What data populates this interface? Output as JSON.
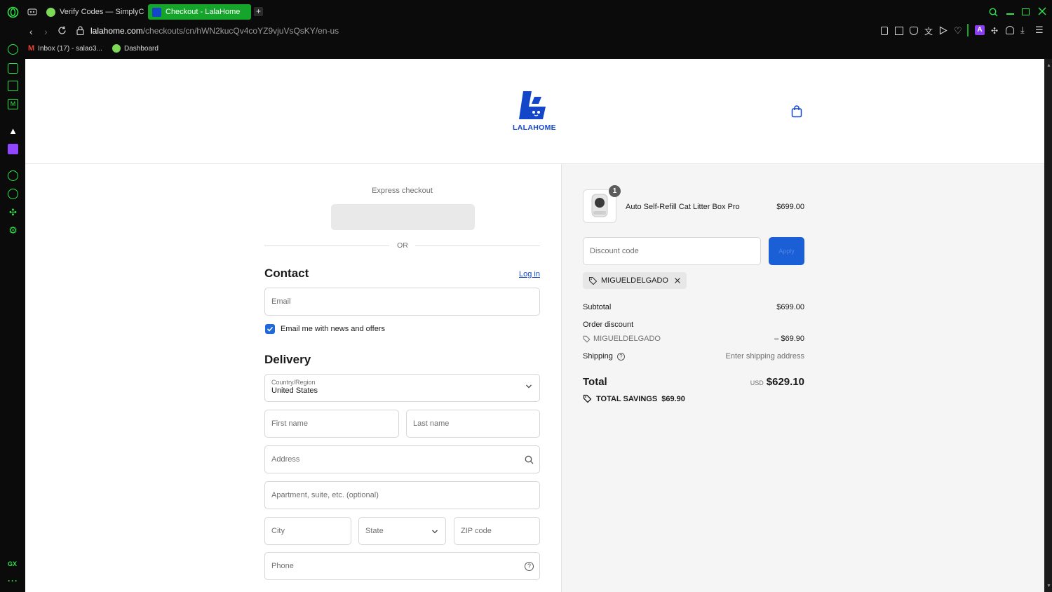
{
  "browser": {
    "tabs": [
      {
        "label": "Verify Codes — SimplyCo",
        "active": false
      },
      {
        "label": "Checkout - LalaHome",
        "active": true
      }
    ],
    "url_host": "lalahome.com",
    "url_path": "/checkouts/cn/hWN2kucQv4coYZ9vjuVsQsKY/en-us",
    "bookmarks": [
      {
        "label": "Inbox (17) - salao3..."
      },
      {
        "label": "Dashboard"
      }
    ],
    "sidebar_bottom_label": "GX",
    "accent_color": "#15a52a"
  },
  "header": {
    "logo_text": "LALAHOME",
    "cart_icon": "shopping-bag-icon",
    "brand_color": "#1346c8"
  },
  "checkout": {
    "express_title": "Express checkout",
    "or_label": "OR",
    "contact": {
      "title": "Contact",
      "login_link": "Log in",
      "email_placeholder": "Email",
      "newsletter_label": "Email me with news and offers",
      "newsletter_checked": true
    },
    "delivery": {
      "title": "Delivery",
      "country_label": "Country/Region",
      "country_value": "United States",
      "first_name_placeholder": "First name",
      "last_name_placeholder": "Last name",
      "address_placeholder": "Address",
      "apartment_placeholder": "Apartment, suite, etc. (optional)",
      "city_placeholder": "City",
      "state_placeholder": "State",
      "zip_placeholder": "ZIP code",
      "phone_placeholder": "Phone"
    }
  },
  "summary": {
    "item": {
      "name": "Auto Self-Refill Cat Litter Box Pro",
      "price": "$699.00",
      "quantity": "1"
    },
    "discount_placeholder": "Discount code",
    "apply_label": "Apply",
    "applied_code": "MIGUELDELGADO",
    "subtotal_label": "Subtotal",
    "subtotal_value": "$699.00",
    "order_discount_label": "Order discount",
    "discount_code_line": "MIGUELDELGADO",
    "discount_value": "– $69.90",
    "shipping_label": "Shipping",
    "shipping_value": "Enter shipping address",
    "total_label": "Total",
    "currency": "USD",
    "total_value": "$629.10",
    "savings_label": "TOTAL SAVINGS",
    "savings_value": "$69.90"
  }
}
